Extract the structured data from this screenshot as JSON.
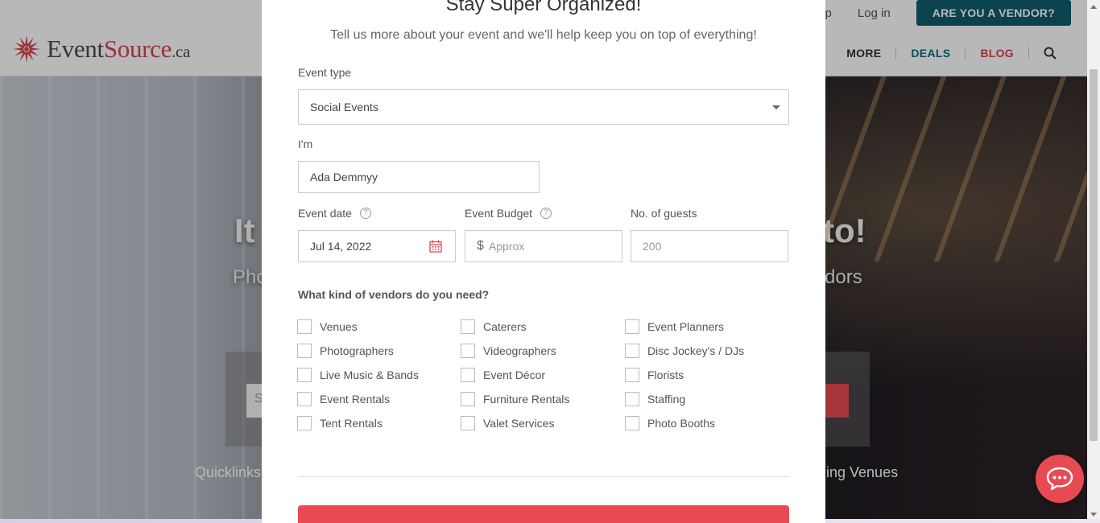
{
  "header": {
    "logo": {
      "main": "Event",
      "accent": "Source",
      "suffix": ".ca"
    },
    "top_links": [
      "Sign up",
      "Log in"
    ],
    "vendor_button": "ARE YOU A VENDOR?",
    "nav": {
      "more": "MORE",
      "deals": "DEALS",
      "blog": "BLOG"
    }
  },
  "hero": {
    "title_left": "It",
    "title_right": "to!",
    "sub_left": "Pho",
    "sub_right": "dors",
    "search_placeholder": "S",
    "quicklinks_left": "Quicklinks",
    "quicklinks_right": "ing Venues"
  },
  "modal": {
    "title": "Stay Super Organized!",
    "subtitle": "Tell us more about your event and we'll help keep you on top of everything!",
    "event_type": {
      "label": "Event type",
      "value": "Social Events"
    },
    "im": {
      "label": "I'm",
      "value": "Ada Demmyy"
    },
    "event_date": {
      "label": "Event date",
      "value": "Jul 14, 2022"
    },
    "event_budget": {
      "label": "Event Budget",
      "placeholder": "Approx",
      "currency": "$"
    },
    "guests": {
      "label": "No. of guests",
      "placeholder": "200"
    },
    "vendors_question": "What kind of vendors do you need?",
    "vendors": [
      [
        "Venues",
        "Caterers",
        "Event Planners"
      ],
      [
        "Photographers",
        "Videographers",
        "Disc Jockey's / DJs"
      ],
      [
        "Live Music & Bands",
        "Event Décor",
        "Florists"
      ],
      [
        "Event Rentals",
        "Furniture Rentals",
        "Staffing"
      ],
      [
        "Tent Rentals",
        "Valet Services",
        "Photo Booths"
      ]
    ]
  },
  "colors": {
    "accent_red": "#e74a53",
    "teal": "#0f5d6b"
  },
  "icons": [
    "calendar-icon",
    "search-icon",
    "chat-icon",
    "help-icon",
    "chevron-down-icon"
  ]
}
